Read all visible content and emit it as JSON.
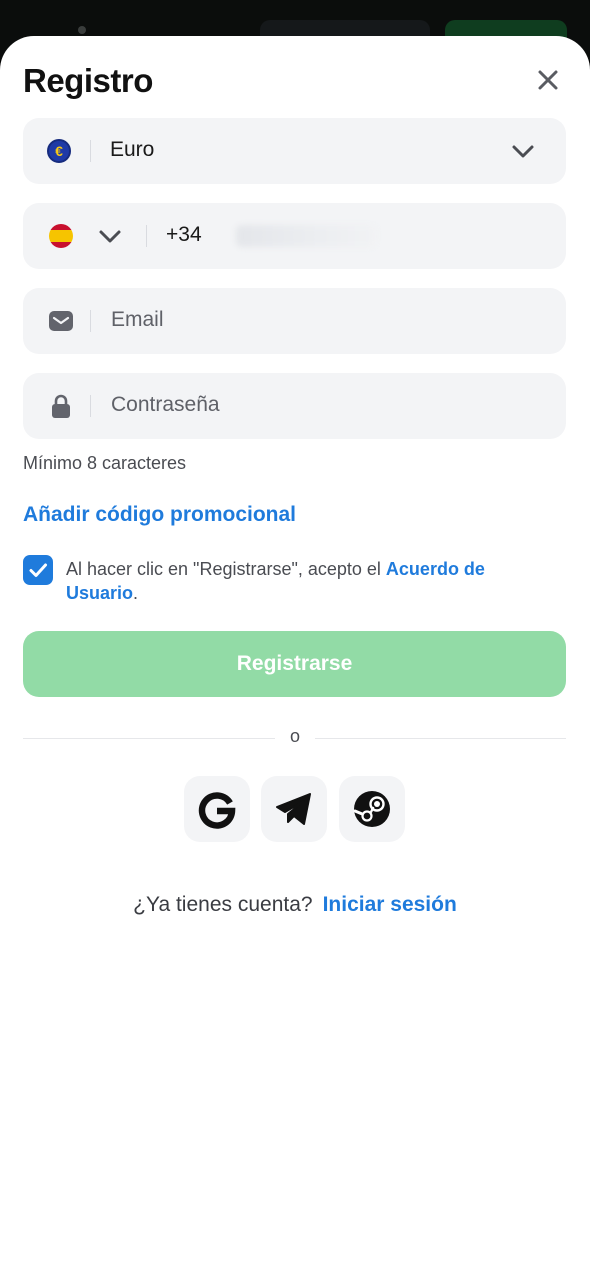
{
  "header": {
    "title": "Registro"
  },
  "currency": {
    "symbol": "€",
    "label": "Euro"
  },
  "phone": {
    "code": "+34",
    "value": "000 00 00 00"
  },
  "email": {
    "placeholder": "Email"
  },
  "password": {
    "placeholder": "Contraseña",
    "hint": "Mínimo 8 caracteres"
  },
  "promo": {
    "label": "Añadir código promocional"
  },
  "terms": {
    "checked": true,
    "text": "Al hacer clic en \"Registrarse\", acepto el ",
    "link": "Acuerdo de Usuario",
    "suffix": "."
  },
  "register_button": {
    "label": "Registrarse"
  },
  "separator": {
    "label": "o"
  },
  "login": {
    "question": "¿Ya tienes cuenta?",
    "link": "Iniciar sesión"
  },
  "colors": {
    "accent": "#1f7bdc",
    "register_disabled": "#92dba6",
    "field_bg": "#f3f4f6"
  }
}
